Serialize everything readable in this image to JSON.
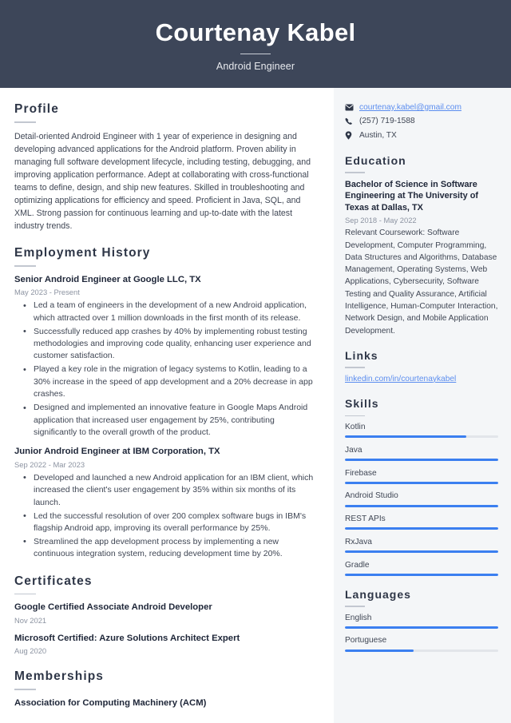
{
  "header": {
    "name": "Courtenay Kabel",
    "job_title": "Android Engineer"
  },
  "colors": {
    "header_bg": "#3d4659",
    "sidebar_bg": "#f4f6f8",
    "heading": "#2e3647",
    "link": "#5b8def",
    "skill_bar": "#3b7ff0",
    "skill_track": "#e2e5ea"
  },
  "main": {
    "profile": {
      "heading": "Profile",
      "text": "Detail-oriented Android Engineer with 1 year of experience in designing and developing advanced applications for the Android platform. Proven ability in managing full software development lifecycle, including testing, debugging, and improving application performance. Adept at collaborating with cross-functional teams to define, design, and ship new features. Skilled in troubleshooting and optimizing applications for efficiency and speed. Proficient in Java, SQL, and XML. Strong passion for continuous learning and up-to-date with the latest industry trends."
    },
    "employment": {
      "heading": "Employment History",
      "entries": [
        {
          "title": "Senior Android Engineer at Google LLC, TX",
          "date": "May 2023 - Present",
          "bullets": [
            "Led a team of engineers in the development of a new Android application, which attracted over 1 million downloads in the first month of its release.",
            "Successfully reduced app crashes by 40% by implementing robust testing methodologies and improving code quality, enhancing user experience and customer satisfaction.",
            "Played a key role in the migration of legacy systems to Kotlin, leading to a 30% increase in the speed of app development and a 20% decrease in app crashes.",
            "Designed and implemented an innovative feature in Google Maps Android application that increased user engagement by 25%, contributing significantly to the overall growth of the product."
          ]
        },
        {
          "title": "Junior Android Engineer at IBM Corporation, TX",
          "date": "Sep 2022 - Mar 2023",
          "bullets": [
            "Developed and launched a new Android application for an IBM client, which increased the client's user engagement by 35% within six months of its launch.",
            "Led the successful resolution of over 200 complex software bugs in IBM's flagship Android app, improving its overall performance by 25%.",
            "Streamlined the app development process by implementing a new continuous integration system, reducing development time by 20%."
          ]
        }
      ]
    },
    "certificates": {
      "heading": "Certificates",
      "entries": [
        {
          "title": "Google Certified Associate Android Developer",
          "date": "Nov 2021"
        },
        {
          "title": "Microsoft Certified: Azure Solutions Architect Expert",
          "date": "Aug 2020"
        }
      ]
    },
    "memberships": {
      "heading": "Memberships",
      "entries": [
        {
          "title": "Association for Computing Machinery (ACM)"
        }
      ]
    }
  },
  "sidebar": {
    "contact": [
      {
        "icon": "envelope-icon",
        "text": "courtenay.kabel@gmail.com",
        "is_link": true
      },
      {
        "icon": "phone-icon",
        "text": "(257) 719-1588",
        "is_link": false
      },
      {
        "icon": "location-pin-icon",
        "text": "Austin, TX",
        "is_link": false
      }
    ],
    "education": {
      "heading": "Education",
      "entries": [
        {
          "title": "Bachelor of Science in Software Engineering at The University of Texas at Dallas, TX",
          "date": "Sep 2018 - May 2022",
          "description": "Relevant Coursework: Software Development, Computer Programming, Data Structures and Algorithms, Database Management, Operating Systems, Web Applications, Cybersecurity, Software Testing and Quality Assurance, Artificial Intelligence, Human-Computer Interaction, Network Design, and Mobile Application Development."
        }
      ]
    },
    "links": {
      "heading": "Links",
      "items": [
        {
          "label": "linkedin.com/in/courtenaykabel"
        }
      ]
    },
    "skills": {
      "heading": "Skills",
      "items": [
        {
          "label": "Kotlin",
          "level": 79
        },
        {
          "label": "Java",
          "level": 100
        },
        {
          "label": "Firebase",
          "level": 100
        },
        {
          "label": "Android Studio",
          "level": 100
        },
        {
          "label": "REST APIs",
          "level": 100
        },
        {
          "label": "RxJava",
          "level": 100
        },
        {
          "label": "Gradle",
          "level": 100
        }
      ]
    },
    "languages": {
      "heading": "Languages",
      "items": [
        {
          "label": "English",
          "level": 100
        },
        {
          "label": "Portuguese",
          "level": 45
        }
      ]
    }
  }
}
